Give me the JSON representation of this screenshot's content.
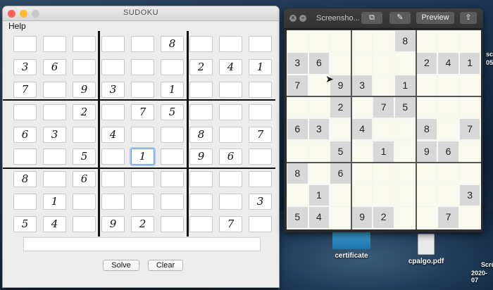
{
  "app": {
    "title": "SUDOKU",
    "menu": [
      "Help"
    ],
    "focused_cell": [
      5,
      4
    ],
    "grid": [
      [
        "",
        "",
        "",
        "",
        "",
        "8",
        "",
        "",
        ""
      ],
      [
        "3",
        "6",
        "",
        "",
        "",
        "",
        "2",
        "4",
        "1"
      ],
      [
        "7",
        "",
        "9",
        "3",
        "",
        "1",
        "",
        "",
        ""
      ],
      [
        "",
        "",
        "2",
        "",
        "7",
        "5",
        "",
        "",
        ""
      ],
      [
        "6",
        "3",
        "",
        "4",
        "",
        "",
        "8",
        "",
        "7"
      ],
      [
        "",
        "",
        "5",
        "",
        "1",
        "",
        "9",
        "6",
        ""
      ],
      [
        "8",
        "",
        "6",
        "",
        "",
        "",
        "",
        "",
        ""
      ],
      [
        "",
        "1",
        "",
        "",
        "",
        "",
        "",
        "",
        "3"
      ],
      [
        "5",
        "4",
        "",
        "9",
        "2",
        "",
        "",
        "7",
        ""
      ]
    ],
    "result_value": "",
    "solve_label": "Solve",
    "clear_label": "Clear",
    "colors": {
      "close": "#fe5f57",
      "minimize": "#febc2e",
      "zoom": "#c8c8c8",
      "focus": "#6aa0e6"
    }
  },
  "preview": {
    "title": "Screensho...",
    "preview_label": "Preview",
    "icons": [
      "close-icon",
      "minimize-icon",
      "copy-icon",
      "markup-icon",
      "share-icon"
    ],
    "grid": [
      [
        "",
        "",
        "",
        "",
        "",
        "8",
        "",
        "",
        ""
      ],
      [
        "3",
        "6",
        "",
        "",
        "",
        "",
        "2",
        "4",
        "1"
      ],
      [
        "7",
        "",
        "9",
        "3",
        "",
        "1",
        "",
        "",
        ""
      ],
      [
        "",
        "",
        "2",
        "",
        "7",
        "5",
        "",
        "",
        ""
      ],
      [
        "6",
        "3",
        "",
        "4",
        "",
        "",
        "8",
        "",
        "7"
      ],
      [
        "",
        "",
        "5",
        "",
        "1",
        "",
        "9",
        "6",
        ""
      ],
      [
        "8",
        "",
        "6",
        "",
        "",
        "",
        "",
        "",
        ""
      ],
      [
        "",
        "1",
        "",
        "",
        "",
        "",
        "",
        "",
        "3"
      ],
      [
        "5",
        "4",
        "",
        "9",
        "2",
        "",
        "",
        "7",
        ""
      ]
    ]
  },
  "desktop": {
    "files": [
      {
        "label": "certificate",
        "icon": "folder-icon"
      },
      {
        "label": "cpalgo.pdf",
        "icon": "pdf-file-icon"
      }
    ],
    "edge_labels": [
      "scr",
      "05",
      "Scre",
      "2020-07"
    ]
  }
}
